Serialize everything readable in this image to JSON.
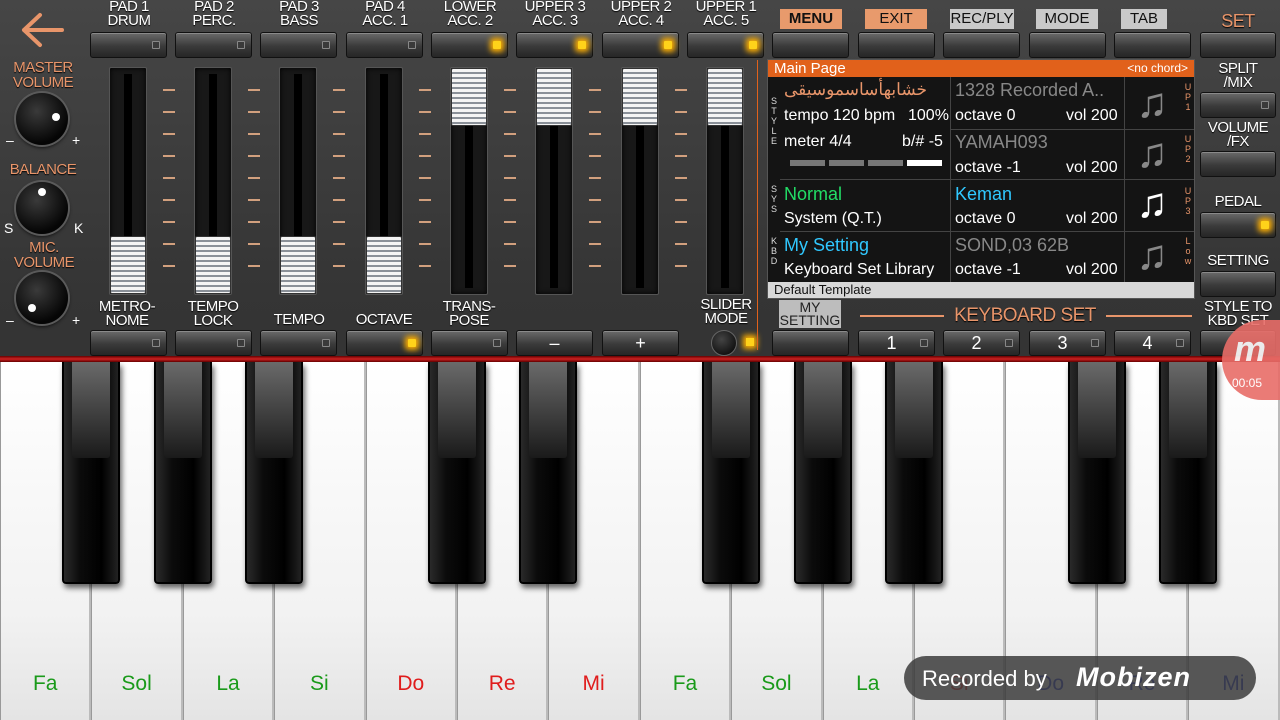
{
  "header": {
    "back_icon": "left-arrow-icon",
    "pads": [
      {
        "line1": "PAD 1",
        "line2": "DRUM",
        "led": false
      },
      {
        "line1": "PAD 2",
        "line2": "PERC.",
        "led": false
      },
      {
        "line1": "PAD 3",
        "line2": "BASS",
        "led": false
      },
      {
        "line1": "PAD 4",
        "line2": "ACC. 1",
        "led": false
      },
      {
        "line1": "LOWER",
        "line2": "ACC. 2",
        "led": true
      },
      {
        "line1": "UPPER 3",
        "line2": "ACC. 3",
        "led": true
      },
      {
        "line1": "UPPER 2",
        "line2": "ACC. 4",
        "led": true
      },
      {
        "line1": "UPPER 1",
        "line2": "ACC. 5",
        "led": true
      }
    ],
    "menu_tabs": [
      "MENU",
      "EXIT",
      "REC/PLY",
      "MODE",
      "TAB"
    ],
    "set_label": "SET"
  },
  "left": {
    "master_volume": "MASTER VOLUME",
    "balance": "BALANCE",
    "mic_volume": "MIC. VOLUME",
    "minus": "–",
    "plus": "+",
    "s": "S",
    "k": "K"
  },
  "sliders": [
    {
      "value": 0.0
    },
    {
      "value": 0.0
    },
    {
      "value": 0.0
    },
    {
      "value": 0.0
    },
    {
      "value": 1.0
    },
    {
      "value": 1.0
    },
    {
      "value": 1.0
    },
    {
      "value": 1.0
    }
  ],
  "bottom_controls": {
    "metronome": "METRO- NOME",
    "tempo_lock": "TEMPO LOCK",
    "tempo": "TEMPO",
    "octave": "OCTAVE",
    "transpose": "TRANS- POSE",
    "minus": "–",
    "plus": "+",
    "slider_mode": "SLIDER MODE",
    "my_setting": "MY SETTING",
    "keyboard_set": "KEYBOARD SET",
    "kbd_set_buttons": [
      "1",
      "2",
      "3",
      "4"
    ],
    "style_to_kbd": "STYLE TO KBD SET"
  },
  "right": {
    "split_mix": "SPLIT /MIX",
    "volume_fx": "VOLUME /FX",
    "pedal": "PEDAL",
    "setting": "SETTING"
  },
  "panel": {
    "title": "Main Page",
    "chord": "<no chord>",
    "style_side": "STYLE",
    "sys_side": "SYS",
    "kbd_side": "KBD",
    "up1_side": "UP1",
    "up2_side": "UP2",
    "up3_side": "UP3",
    "low_side": "Low",
    "style_name": "خشابهأساسموسيقى",
    "tempo": "tempo 120 bpm",
    "tempo_pct": "100%",
    "meter": "meter 4/4",
    "key_sig": "b/# -5",
    "up1_name": "1328 Recorded A..",
    "up1_octave": "octave  0",
    "up1_vol": "vol 200",
    "up2_name": "YAMAH093",
    "up2_octave": "octave -1",
    "up2_vol": "vol 200",
    "sys_name": "Normal",
    "sys_sub": "System (Q.T.)",
    "up3_name": "Keman",
    "up3_octave": "octave  0",
    "up3_vol": "vol 200",
    "kbd_name": "My Setting",
    "kbd_sub": "Keyboard Set Library",
    "low_name": "SOND,03 62B",
    "low_octave": "octave -1",
    "low_vol": "vol 200",
    "footer": "Default Template",
    "note_icon": "music-note-icon"
  },
  "keys": {
    "white": [
      "Fa",
      "Sol",
      "La",
      "Si",
      "Do",
      "Re",
      "Mi",
      "Fa",
      "Sol",
      "La",
      "Si",
      "Do",
      "Re",
      "Mi"
    ],
    "colors": {
      "green": "#1a9a1a",
      "red": "#e01c1c",
      "blue": "#2030c0"
    }
  },
  "overlay": {
    "recorded_by": "Recorded by",
    "brand": "Mobizen",
    "timer": "00:05"
  }
}
